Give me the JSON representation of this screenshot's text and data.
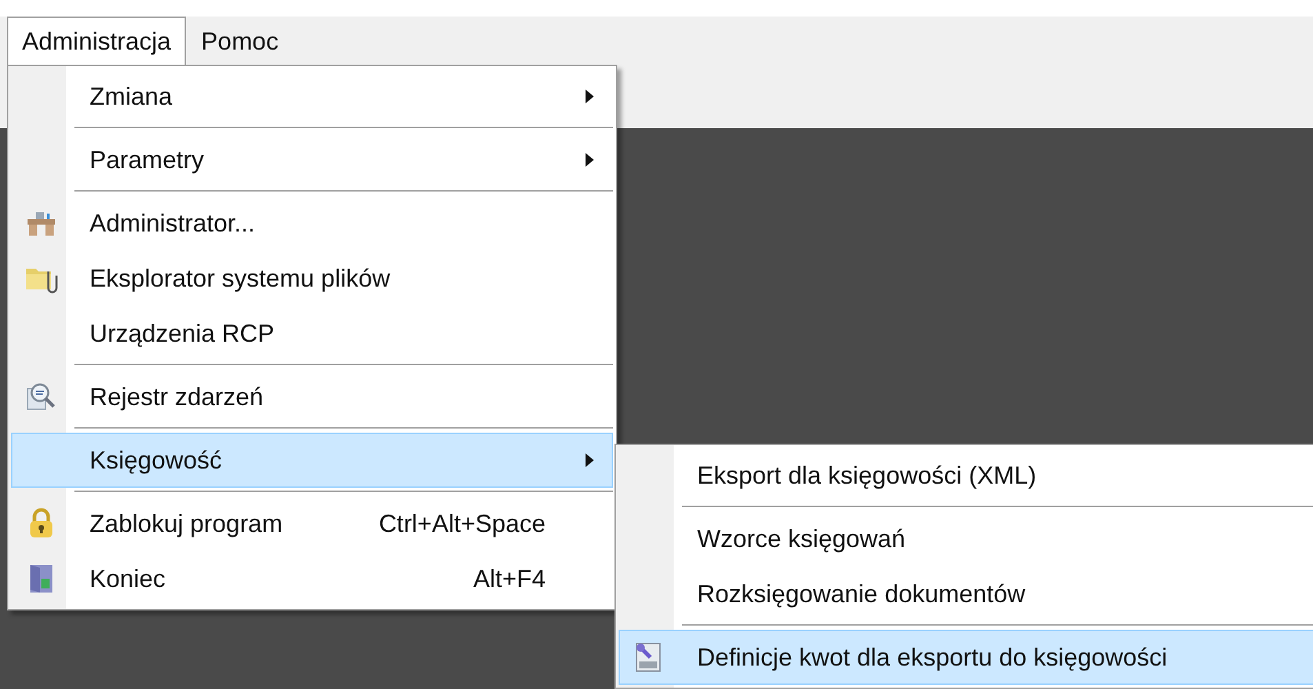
{
  "menubar": [
    {
      "label": "Administracja",
      "selected": true
    },
    {
      "label": "Pomoc",
      "selected": false
    }
  ],
  "menu": [
    {
      "kind": "item",
      "label": "Zmiana",
      "submenu": true,
      "selected": false
    },
    {
      "kind": "separator"
    },
    {
      "kind": "item",
      "label": "Parametry",
      "submenu": true,
      "selected": false
    },
    {
      "kind": "separator"
    },
    {
      "kind": "item",
      "label": "Administrator...",
      "selected": false
    },
    {
      "kind": "item",
      "label": "Eksplorator systemu plików",
      "selected": false
    },
    {
      "kind": "item",
      "label": "Urządzenia RCP",
      "selected": false
    },
    {
      "kind": "separator"
    },
    {
      "kind": "item",
      "label": "Rejestr zdarzeń",
      "selected": false
    },
    {
      "kind": "separator"
    },
    {
      "kind": "item",
      "label": "Księgowość",
      "submenu": true,
      "selected": true
    },
    {
      "kind": "separator"
    },
    {
      "kind": "item",
      "label": "Zablokuj program",
      "shortcut": "Ctrl+Alt+Space",
      "selected": false
    },
    {
      "kind": "item",
      "label": "Koniec",
      "shortcut": "Alt+F4",
      "selected": false
    }
  ],
  "submenu": [
    {
      "kind": "item",
      "label": "Eksport dla księgowości (XML)",
      "selected": false
    },
    {
      "kind": "separator"
    },
    {
      "kind": "item",
      "label": "Wzorce księgowań",
      "selected": false
    },
    {
      "kind": "item",
      "label": "Rozksięgowanie dokumentów",
      "selected": false
    },
    {
      "kind": "separator"
    },
    {
      "kind": "item",
      "label": "Definicje kwot dla eksportu do księgowości",
      "selected": true
    }
  ]
}
